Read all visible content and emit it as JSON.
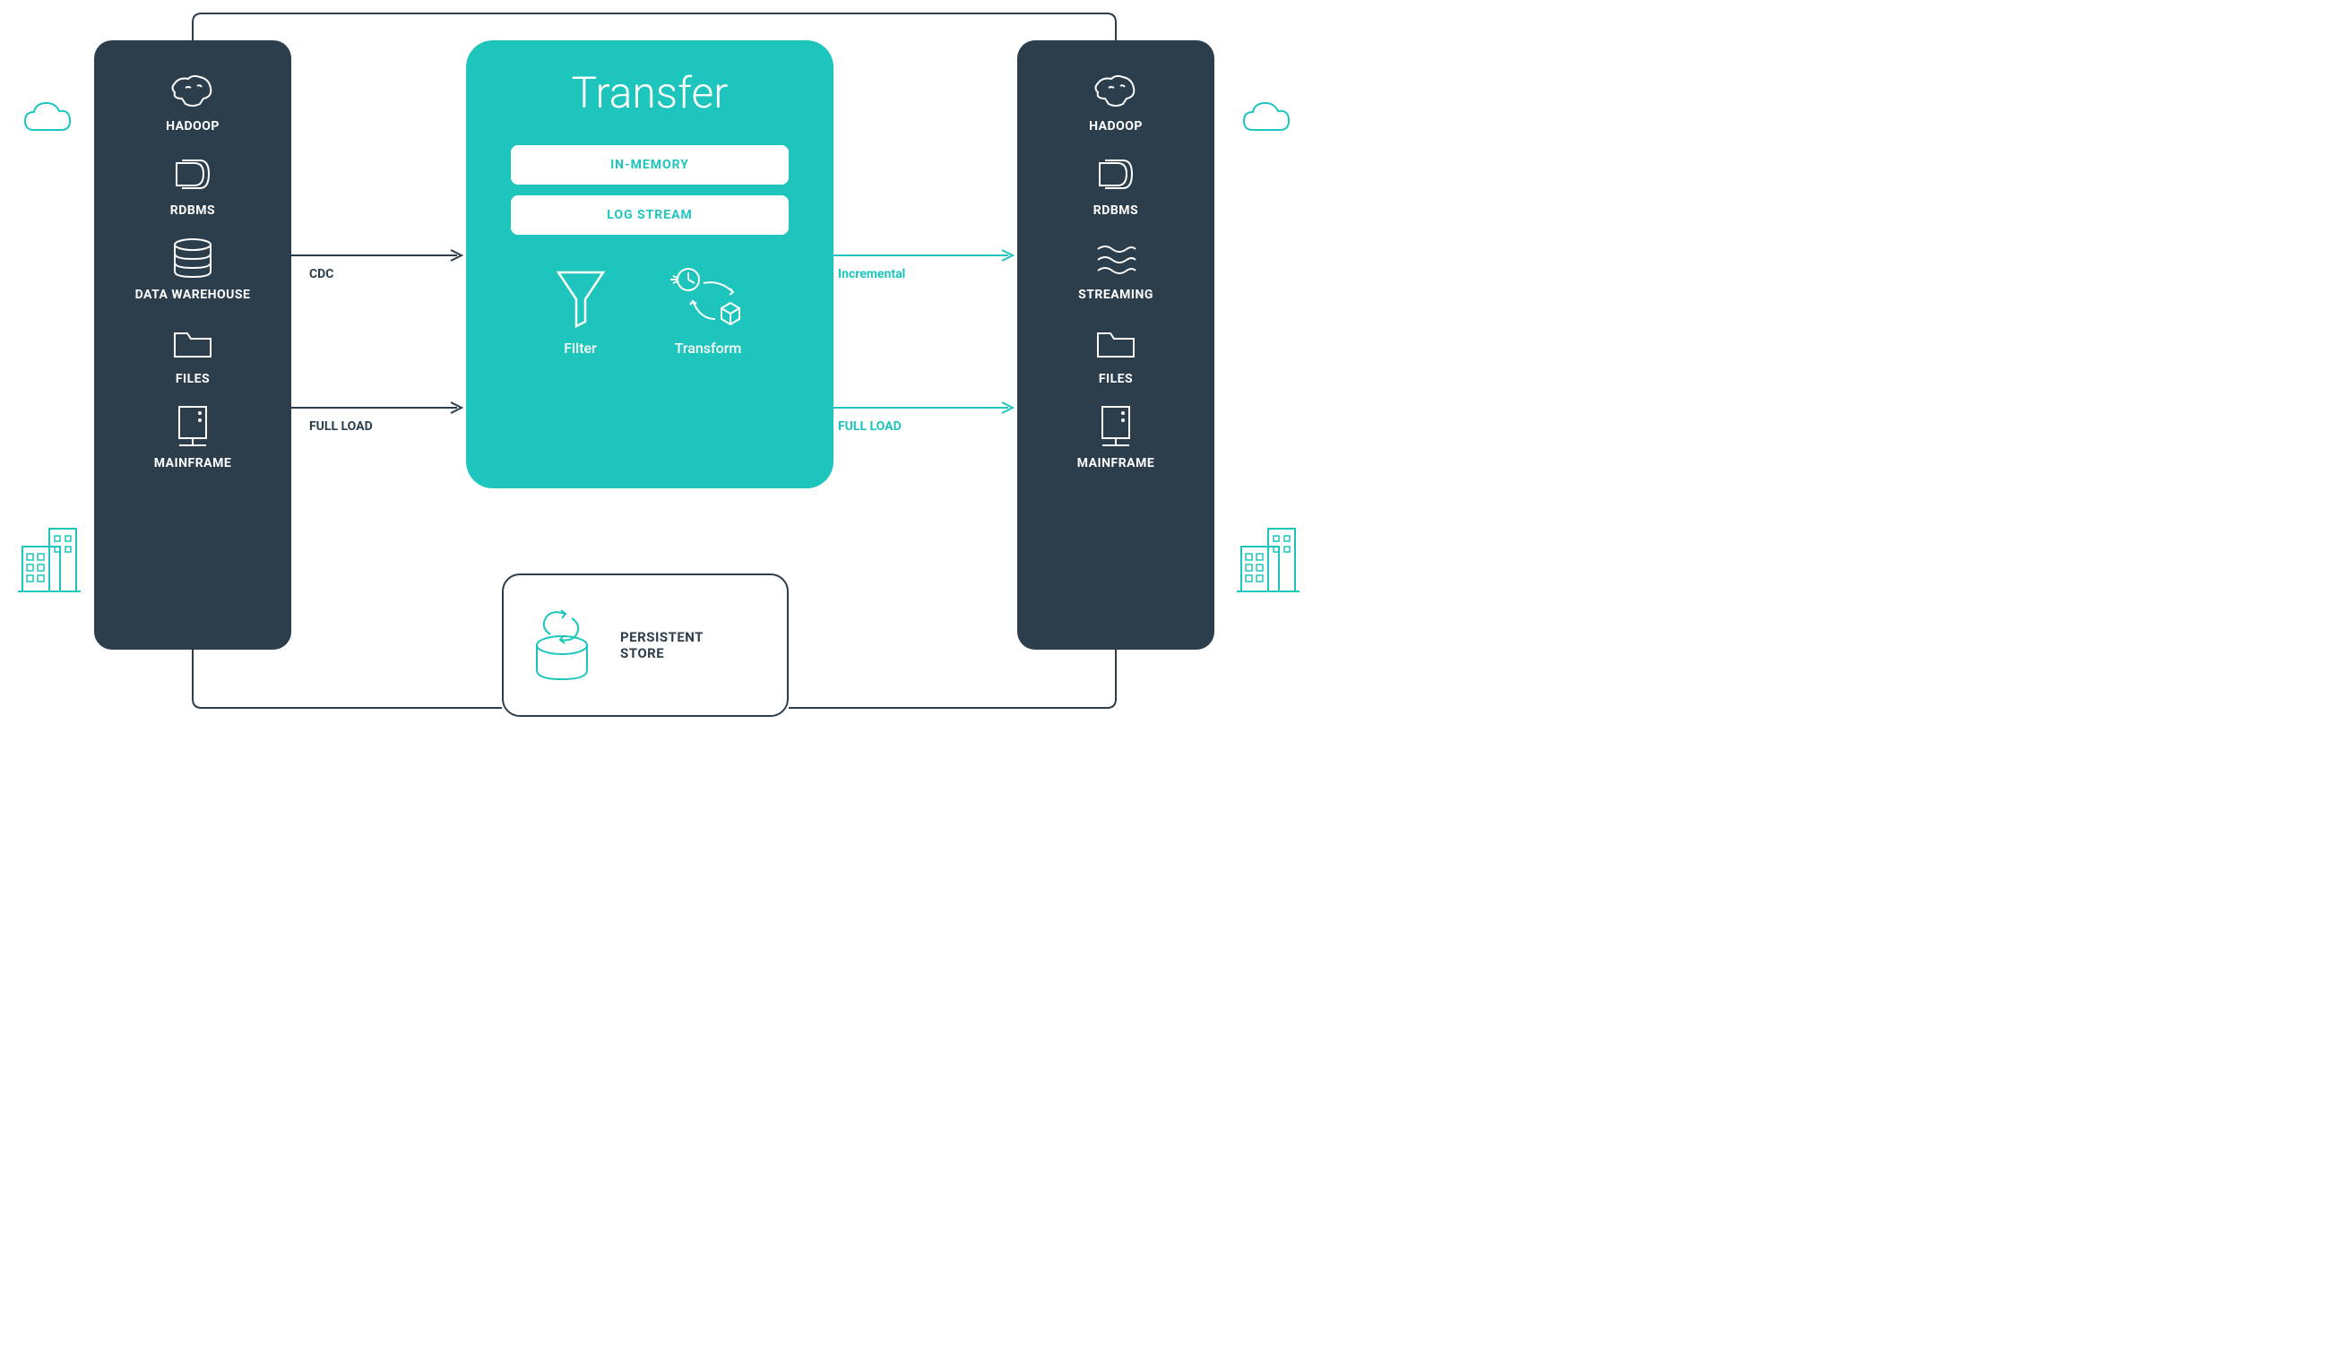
{
  "source_panel": {
    "items": [
      {
        "label": "HADOOP",
        "icon": "hadoop-icon"
      },
      {
        "label": "RDBMS",
        "icon": "rdbms-icon"
      },
      {
        "label": "DATA WAREHOUSE",
        "icon": "database-icon"
      },
      {
        "label": "FILES",
        "icon": "folder-icon"
      },
      {
        "label": "MAINFRAME",
        "icon": "server-icon"
      }
    ]
  },
  "target_panel": {
    "items": [
      {
        "label": "HADOOP",
        "icon": "hadoop-icon"
      },
      {
        "label": "RDBMS",
        "icon": "rdbms-icon"
      },
      {
        "label": "STREAMING",
        "icon": "waves-icon"
      },
      {
        "label": "FILES",
        "icon": "folder-icon"
      },
      {
        "label": "MAINFRAME",
        "icon": "server-icon"
      }
    ]
  },
  "center": {
    "title": "Transfer",
    "pill1": "IN-MEMORY",
    "pill2": "LOG STREAM",
    "filter_label": "Filter",
    "transform_label": "Transform"
  },
  "arrows": {
    "cdc": "CDC",
    "full_load_left": "FULL LOAD",
    "incremental": "Incremental",
    "full_load_right": "FULL LOAD"
  },
  "persist": {
    "label_line1": "PERSISTENT",
    "label_line2": "STORE"
  }
}
